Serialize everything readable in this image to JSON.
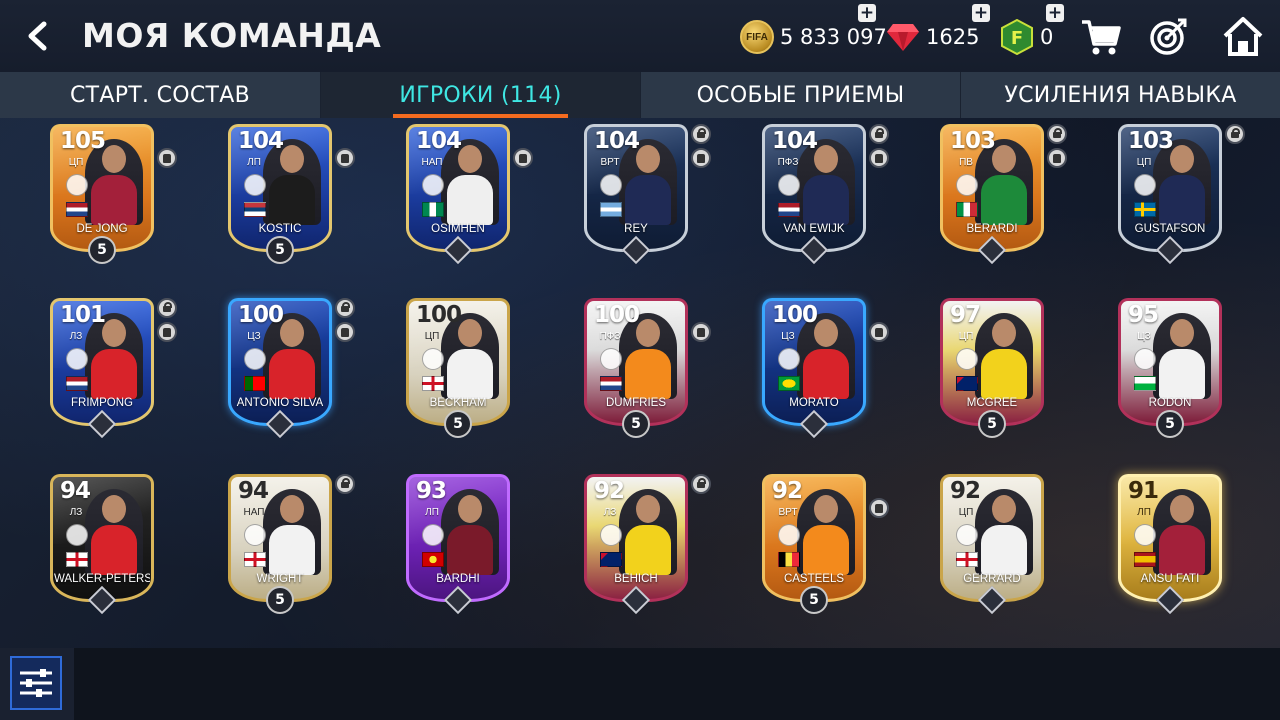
{
  "header": {
    "title": "МОЯ КОМАНДА",
    "currency": {
      "fifa_points_label": "FIFA",
      "fifa_points": "5 833 097",
      "gems": "1625",
      "fc_points_label": "F",
      "fc_points": "0"
    },
    "plus_label": "+",
    "icons": [
      "back-icon",
      "ruby-gem-icon",
      "fc-points-icon",
      "shopping-cart-icon",
      "target-icon",
      "home-icon"
    ]
  },
  "tabs": [
    {
      "label": "СТАРТ. СОСТАВ",
      "active": false
    },
    {
      "label": "ИГРОКИ (114)",
      "active": true
    },
    {
      "label": "ОСОБЫЕ ПРИЕМЫ",
      "active": false
    },
    {
      "label": "УСИЛЕНИЯ НАВЫКА",
      "active": false
    }
  ],
  "colors": {
    "accent_active_tab": "#3fe7e3",
    "tab_underline": "#f46b1f",
    "background": "#121a2b"
  },
  "players": [
    {
      "rating": "105",
      "pos": "ЦП",
      "name": "DE JONG",
      "tier": "t-orange",
      "flag": "netherlands",
      "kit": "#a3203a",
      "rank": "5",
      "lock": false,
      "shirt": true
    },
    {
      "rating": "104",
      "pos": "ЛП",
      "name": "KOSTIĆ",
      "tier": "t-blue",
      "flag": "serbia",
      "kit": "#1c1c1c",
      "rank": "5",
      "lock": false,
      "shirt": true
    },
    {
      "rating": "104",
      "pos": "НАП",
      "name": "OSIMHEN",
      "tier": "t-blue",
      "flag": "nigeria",
      "kit": "#efefef",
      "rank": "",
      "lock": false,
      "shirt": true
    },
    {
      "rating": "104",
      "pos": "ВРТ",
      "name": "REY",
      "tier": "t-navy",
      "flag": "argentina",
      "kit": "#1f2a55",
      "rank": "",
      "lock": true,
      "shirt": true
    },
    {
      "rating": "104",
      "pos": "ПФЗ",
      "name": "VAN EWIJK",
      "tier": "t-navy",
      "flag": "netherlands",
      "kit": "#1f2a55",
      "rank": "",
      "lock": true,
      "shirt": true
    },
    {
      "rating": "103",
      "pos": "ПВ",
      "name": "BERARDI",
      "tier": "t-orange",
      "flag": "italy",
      "kit": "#1d8a3a",
      "rank": "",
      "lock": true,
      "shirt": true
    },
    {
      "rating": "103",
      "pos": "ЦП",
      "name": "GUSTAFSON",
      "tier": "t-navy",
      "flag": "sweden",
      "kit": "#1f2a55",
      "rank": "",
      "lock": true,
      "shirt": false
    },
    {
      "rating": "101",
      "pos": "ЛЗ",
      "name": "FRIMPONG",
      "tier": "t-blue",
      "flag": "netherlands",
      "kit": "#d8232a",
      "rank": "",
      "lock": true,
      "shirt": true
    },
    {
      "rating": "100",
      "pos": "ЦЗ",
      "name": "ANTÓNIO SILVA",
      "tier": "t-tots",
      "flag": "portugal",
      "kit": "#d8232a",
      "rank": "",
      "lock": true,
      "shirt": true
    },
    {
      "rating": "100",
      "pos": "ЦП",
      "name": "BECKHAM",
      "tier": "t-icon",
      "flag": "england",
      "kit": "#f2f2f2",
      "rank": "5",
      "lock": false,
      "shirt": false
    },
    {
      "rating": "100",
      "pos": "ПФЗ",
      "name": "DUMFRIES",
      "tier": "t-wc2",
      "flag": "netherlands",
      "kit": "#f38a1c",
      "rank": "5",
      "lock": false,
      "shirt": true
    },
    {
      "rating": "100",
      "pos": "ЦЗ",
      "name": "MORATO",
      "tier": "t-tots",
      "flag": "brazil",
      "kit": "#d8232a",
      "rank": "",
      "lock": false,
      "shirt": true
    },
    {
      "rating": "97",
      "pos": "ЦП",
      "name": "MCGREE",
      "tier": "t-wc",
      "flag": "australia",
      "kit": "#f2d21c",
      "rank": "5",
      "lock": false,
      "shirt": false
    },
    {
      "rating": "95",
      "pos": "ЦЗ",
      "name": "RODON",
      "tier": "t-wc2",
      "flag": "wales",
      "kit": "#f2f2f2",
      "rank": "5",
      "lock": false,
      "shirt": false
    },
    {
      "rating": "94",
      "pos": "ЛЗ",
      "name": "WALKER-PETERS",
      "tier": "t-black",
      "flag": "england",
      "kit": "#d8232a",
      "rank": "",
      "lock": false,
      "shirt": false
    },
    {
      "rating": "94",
      "pos": "НАП",
      "name": "WRIGHT",
      "tier": "t-icon",
      "flag": "england",
      "kit": "#f2f2f2",
      "rank": "5",
      "lock": true,
      "shirt": false
    },
    {
      "rating": "93",
      "pos": "ЛП",
      "name": "BARDHI",
      "tier": "t-purple",
      "flag": "macedonia",
      "kit": "#7a1a2a",
      "rank": "",
      "lock": false,
      "shirt": false
    },
    {
      "rating": "92",
      "pos": "ЛЗ",
      "name": "BEHICH",
      "tier": "t-wc",
      "flag": "australia",
      "kit": "#f2d21c",
      "rank": "",
      "lock": true,
      "shirt": false
    },
    {
      "rating": "92",
      "pos": "ВРТ",
      "name": "CASTEELS",
      "tier": "t-orange",
      "flag": "belgium",
      "kit": "#f38a1c",
      "rank": "5",
      "lock": false,
      "shirt": true
    },
    {
      "rating": "92",
      "pos": "ЦП",
      "name": "GERRARD",
      "tier": "t-icon",
      "flag": "england",
      "kit": "#f2f2f2",
      "rank": "",
      "lock": false,
      "shirt": false
    },
    {
      "rating": "91",
      "pos": "ЛП",
      "name": "ANSU FATI",
      "tier": "t-gold",
      "flag": "spain",
      "kit": "#a3203a",
      "rank": "",
      "lock": false,
      "shirt": false
    }
  ],
  "footer": {
    "filter_icon": "sliders-icon"
  }
}
